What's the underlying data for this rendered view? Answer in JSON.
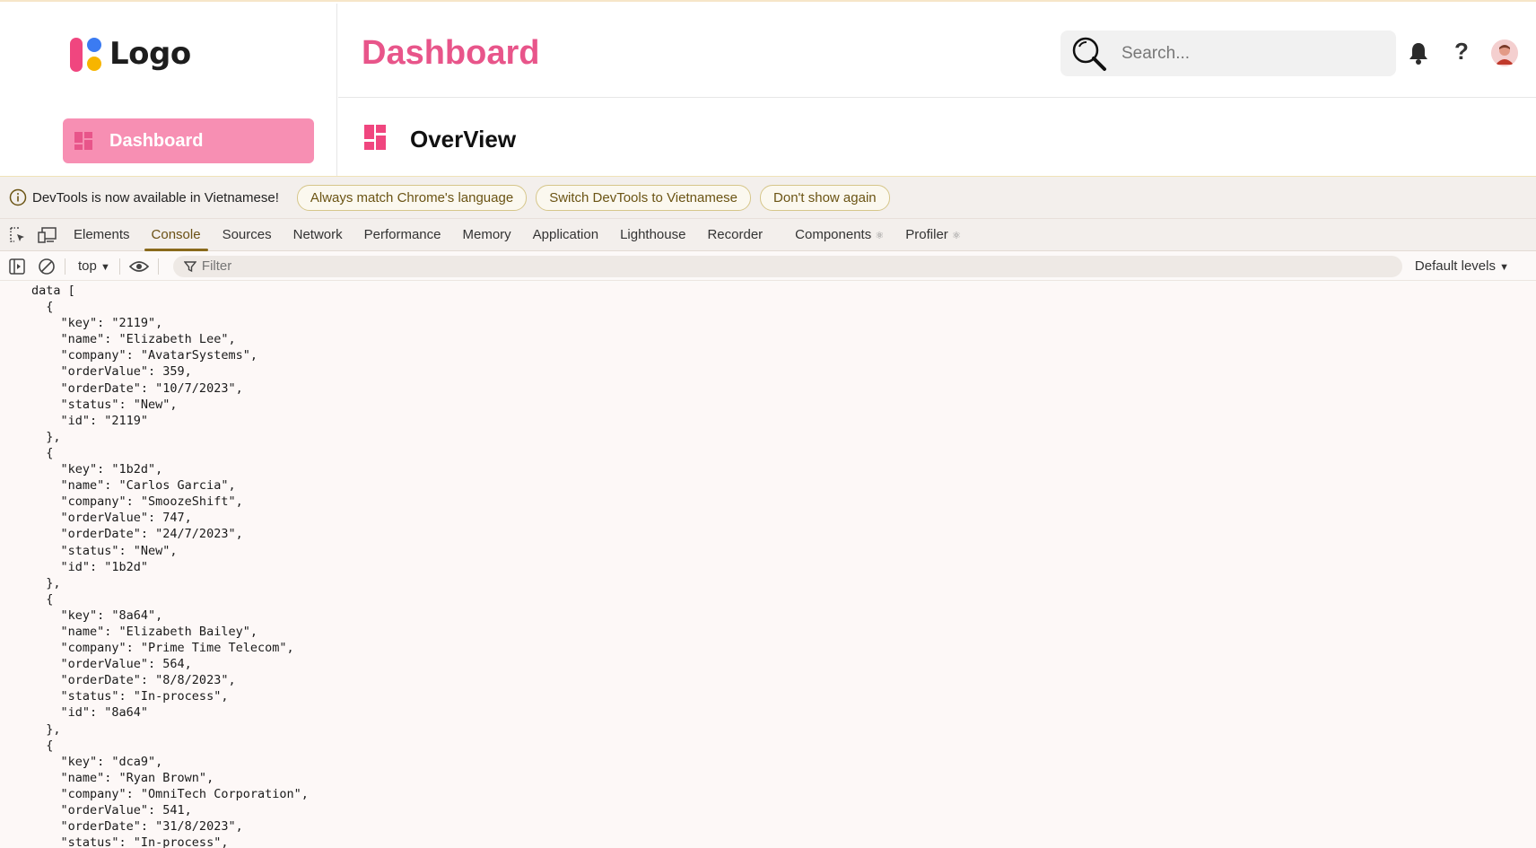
{
  "app": {
    "logo_text": "Logo",
    "page_title": "Dashboard",
    "sidebar": {
      "items": [
        {
          "label": "Dashboard",
          "active": true,
          "icon": "dashboard-icon"
        }
      ]
    },
    "search": {
      "placeholder": "Search..."
    },
    "help_label": "?",
    "subheader_title": "OverView",
    "colors": {
      "accent": "#e8558a",
      "sidebar_active_bg": "#f78fb3"
    }
  },
  "devtools": {
    "info": {
      "text": "DevTools is now available in Vietnamese!",
      "buttons": [
        "Always match Chrome's language",
        "Switch DevTools to Vietnamese",
        "Don't show again"
      ]
    },
    "tabs": [
      "Elements",
      "Console",
      "Sources",
      "Network",
      "Performance",
      "Memory",
      "Application",
      "Lighthouse",
      "Recorder",
      "Components",
      "Profiler"
    ],
    "active_tab": "Console",
    "toolbar": {
      "context": "top",
      "filter_placeholder": "Filter",
      "levels": "Default levels"
    },
    "console_output": "data [\n  {\n    \"key\": \"2119\",\n    \"name\": \"Elizabeth Lee\",\n    \"company\": \"AvatarSystems\",\n    \"orderValue\": 359,\n    \"orderDate\": \"10/7/2023\",\n    \"status\": \"New\",\n    \"id\": \"2119\"\n  },\n  {\n    \"key\": \"1b2d\",\n    \"name\": \"Carlos Garcia\",\n    \"company\": \"SmoozeShift\",\n    \"orderValue\": 747,\n    \"orderDate\": \"24/7/2023\",\n    \"status\": \"New\",\n    \"id\": \"1b2d\"\n  },\n  {\n    \"key\": \"8a64\",\n    \"name\": \"Elizabeth Bailey\",\n    \"company\": \"Prime Time Telecom\",\n    \"orderValue\": 564,\n    \"orderDate\": \"8/8/2023\",\n    \"status\": \"In-process\",\n    \"id\": \"8a64\"\n  },\n  {\n    \"key\": \"dca9\",\n    \"name\": \"Ryan Brown\",\n    \"company\": \"OmniTech Corporation\",\n    \"orderValue\": 541,\n    \"orderDate\": \"31/8/2023\",\n    \"status\": \"In-process\","
  }
}
